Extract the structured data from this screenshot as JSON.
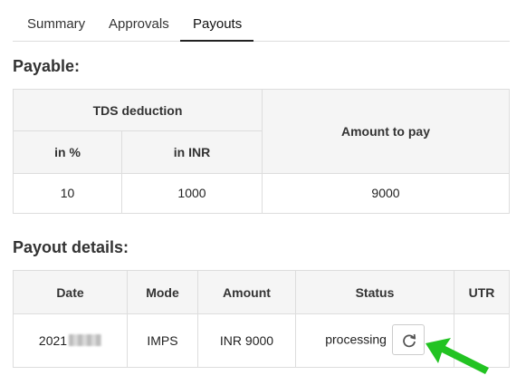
{
  "tabs": [
    {
      "label": "Summary"
    },
    {
      "label": "Approvals"
    },
    {
      "label": "Payouts"
    }
  ],
  "payable": {
    "heading": "Payable:",
    "tds_header": "TDS deduction",
    "col_percent": "in %",
    "col_inr": "in INR",
    "col_amount": "Amount to pay",
    "row": {
      "percent": "10",
      "inr": "1000",
      "amount": "9000"
    }
  },
  "payout": {
    "heading": "Payout details:",
    "headers": {
      "date": "Date",
      "mode": "Mode",
      "amount": "Amount",
      "status": "Status",
      "utr": "UTR"
    },
    "row": {
      "date": "2021",
      "mode": "IMPS",
      "amount": "INR 9000",
      "status": "processing",
      "utr": ""
    }
  },
  "icons": {
    "refresh": "refresh-icon",
    "annotation": "arrow-icon"
  },
  "colors": {
    "arrow": "#22c322",
    "header_bg": "#f5f5f5",
    "border": "#dddddd"
  }
}
